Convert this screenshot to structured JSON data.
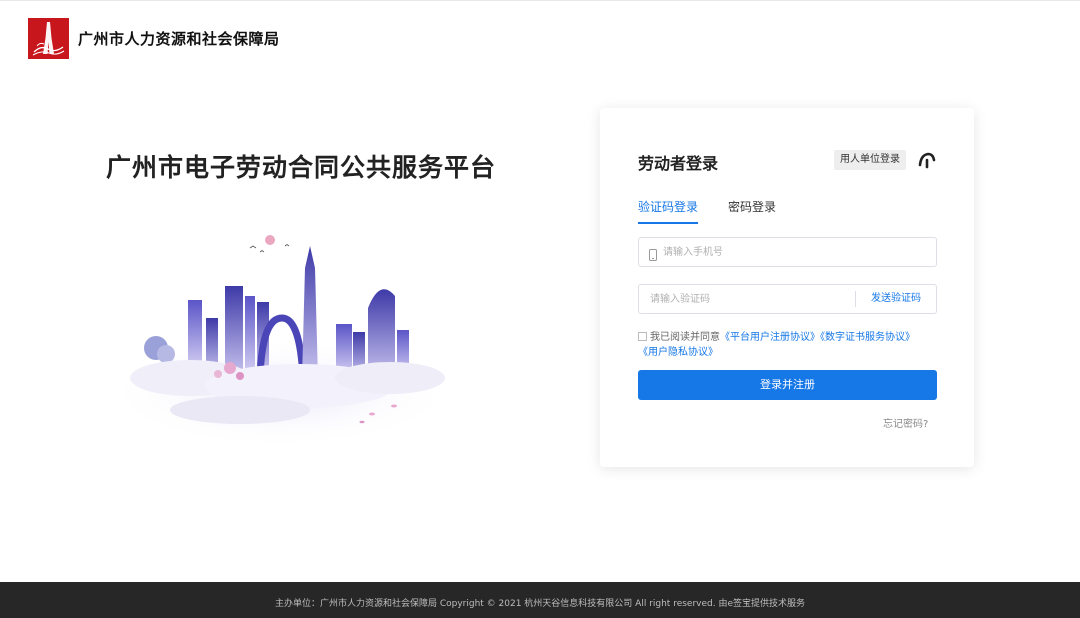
{
  "header": {
    "org_name": "广州市人力资源和社会保障局"
  },
  "hero": {
    "title": "广州市电子劳动合同公共服务平台"
  },
  "login": {
    "title": "劳动者登录",
    "employer_login": "用人单位登录",
    "tabs": [
      {
        "label": "验证码登录",
        "active": true
      },
      {
        "label": "密码登录",
        "active": false
      }
    ],
    "phone_placeholder": "请输入手机号",
    "code_placeholder": "请输入验证码",
    "send_code": "发送验证码",
    "agreement": {
      "prefix": "我已阅读并同意",
      "links": [
        "《平台用户注册协议》",
        "《数字证书服务协议》",
        "《用户隐私协议》"
      ],
      "checked": false
    },
    "submit": "登录并注册",
    "forgot": "忘记密码?"
  },
  "footer": {
    "text": "主办单位：广州市人力资源和社会保障局 Copyright © 2021 杭州天谷信息科技有限公司 All right reserved. 由e签宝提供技术服务"
  },
  "colors": {
    "primary": "#1677e6",
    "logo_red": "#c8161d",
    "footer_bg": "#272727"
  },
  "icons": {
    "logo": "canton-tower-logo",
    "switch": "account-switch-icon",
    "phone": "phone-icon"
  }
}
